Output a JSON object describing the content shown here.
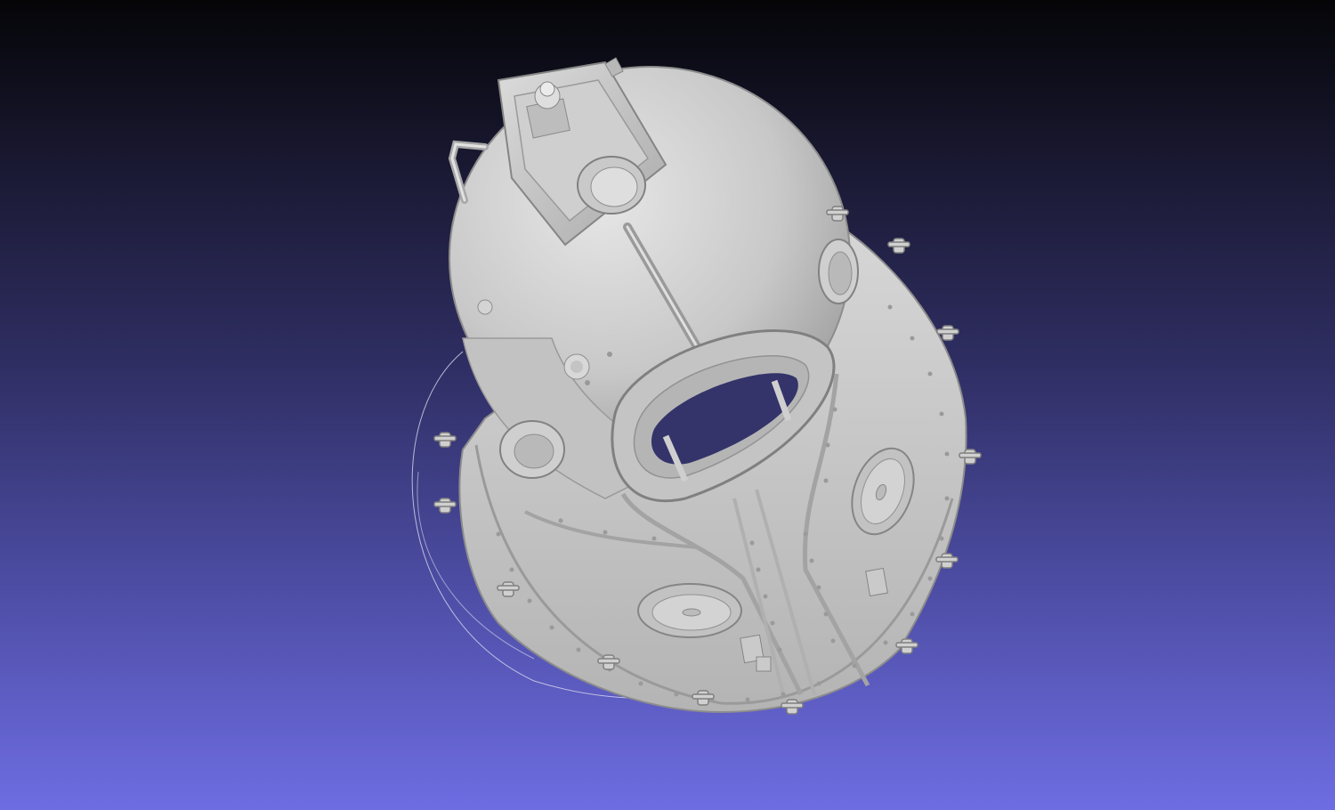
{
  "viewer": {
    "background_top": "#050508",
    "background_bottom": "#6e6de2",
    "model_color": "#c9c9c9",
    "trackball_colors": [
      "#d9d9ee",
      "#e07a8a",
      "#7ecf7e"
    ]
  },
  "model": {
    "parts": [
      "helmet-dome",
      "top-box",
      "side-handle",
      "faceplate-window",
      "breastplate",
      "side-porthole-left",
      "side-porthole-right",
      "chest-porthole-left",
      "chest-porthole-right",
      "wing-bolts"
    ]
  }
}
